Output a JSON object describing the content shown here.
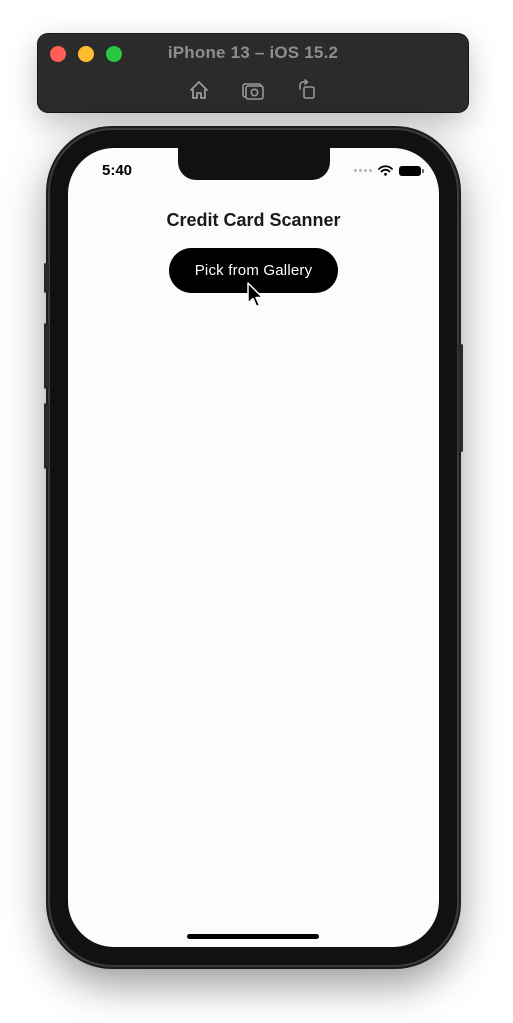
{
  "window": {
    "title": "iPhone 13 – iOS 15.2",
    "toolbar_icons": [
      "home-icon",
      "screenshot-icon",
      "rotate-icon"
    ]
  },
  "status_bar": {
    "time": "5:40",
    "icons": [
      "cellular-icon",
      "wifi-icon",
      "battery-icon"
    ]
  },
  "app": {
    "title": "Credit Card Scanner",
    "pick_button_label": "Pick from Gallery"
  },
  "colors": {
    "button_bg": "#000000",
    "button_text": "#ffffff",
    "screen_bg": "#fcfcfc",
    "toolbar_bg": "#2b2b2b"
  }
}
